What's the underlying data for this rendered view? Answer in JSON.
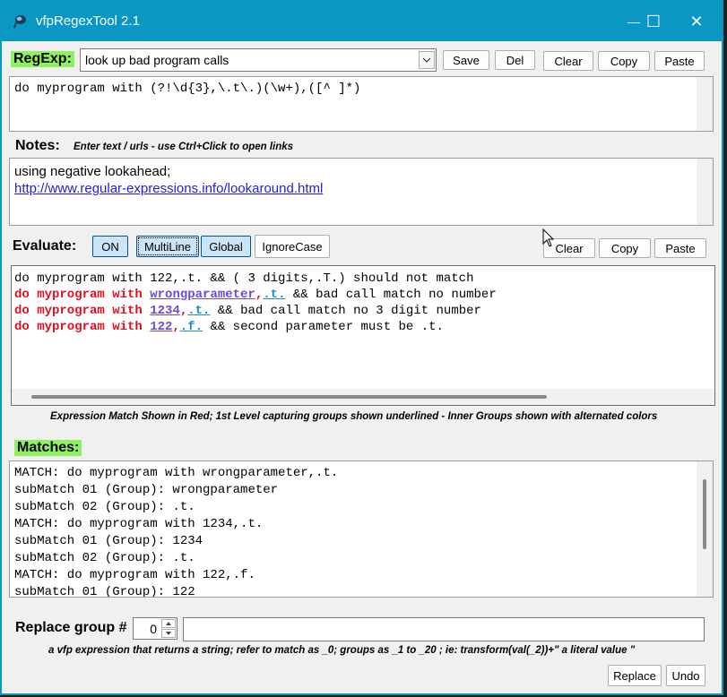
{
  "window": {
    "title": "vfpRegexTool 2.1",
    "minimize_glyph": "—",
    "maximize_glyph": "☐",
    "close_glyph": "✕"
  },
  "regexp": {
    "label": "RegExp:",
    "selected": "look up bad program calls",
    "buttons": {
      "save": "Save",
      "del": "Del",
      "clear": "Clear",
      "copy": "Copy",
      "paste": "Paste"
    },
    "pattern": "do myprogram with (?!\\d{3},\\.t\\.)(\\w+),([^ ]*)"
  },
  "notes": {
    "label": "Notes:",
    "hint": "Enter text / urls - use Ctrl+Click to open links",
    "line1": "using negative lookahead;",
    "link": "http://www.regular-expressions.info/lookaround.html"
  },
  "evaluate": {
    "label": "Evaluate:",
    "toggles": {
      "on": "ON",
      "multiline": "MultiLine",
      "global": "Global",
      "ignorecase": "IgnoreCase"
    },
    "buttons": {
      "clear": "Clear",
      "copy": "Copy",
      "paste": "Paste"
    },
    "lines": [
      {
        "plain": "do myprogram with 122,.t. && ( 3 digits,.T.) should not match"
      },
      {
        "prefix": "do myprogram with ",
        "group1": "wrongparameter",
        "sep": ",",
        "group2": ".t.",
        "rest": " && bad call match no number"
      },
      {
        "prefix": "do myprogram with ",
        "group1": "1234",
        "sep": ",",
        "group2": ".t.",
        "rest": " && bad call match no 3 digit number"
      },
      {
        "prefix": "do myprogram with ",
        "group1": "122",
        "sep": ",",
        "group2": ".f.",
        "rest": " && second parameter must be .t."
      }
    ],
    "legend": "Expression Match Shown in Red; 1st Level capturing groups shown underlined - Inner Groups shown with alternated colors"
  },
  "matches": {
    "label": "Matches:",
    "lines": [
      "MATCH: do myprogram with wrongparameter,.t.",
      "subMatch 01 (Group): wrongparameter",
      "subMatch 02 (Group): .t.",
      "MATCH: do myprogram with 1234,.t.",
      "subMatch 01 (Group): 1234",
      "subMatch 02 (Group): .t.",
      "MATCH: do myprogram with 122,.f.",
      "subMatch 01 (Group): 122"
    ]
  },
  "replace": {
    "label": "Replace group #",
    "group_value": "0",
    "expression_value": "",
    "hint": "a vfp expression that returns a string; refer to match as _0; groups as _1 to _20 ; ie: transform(val(_2))+\" a literal value \"",
    "buttons": {
      "replace": "Replace",
      "undo": "Undo"
    }
  }
}
